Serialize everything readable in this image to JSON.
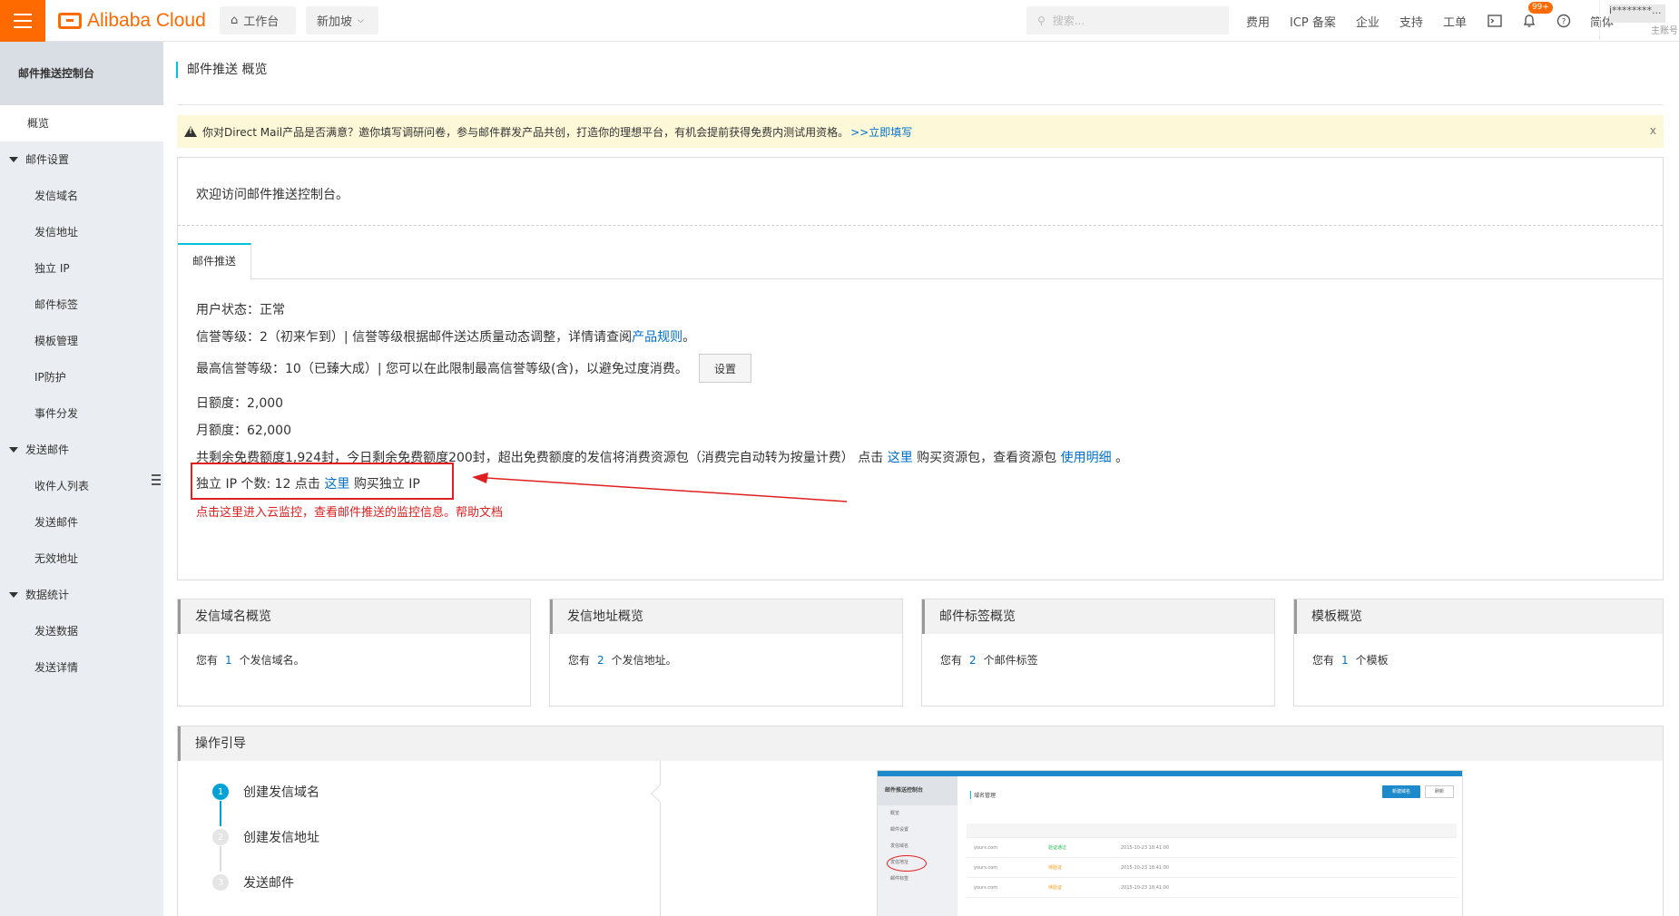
{
  "topbar": {
    "brand": "Alibaba Cloud",
    "workspace_label": "工作台",
    "region_label": "新加坡",
    "search_placeholder": "搜索...",
    "links": [
      "费用",
      "ICP 备案",
      "企业",
      "支持",
      "工单"
    ],
    "notification_badge": "99+",
    "lang_label": "简体",
    "user_name": "i********...",
    "user_sub": "主账号"
  },
  "sidebar": {
    "title": "邮件推送控制台",
    "overview": "概览",
    "groups": [
      {
        "label": "邮件设置",
        "items": [
          "发信域名",
          "发信地址",
          "独立 IP",
          "邮件标签",
          "模板管理",
          "IP防护",
          "事件分发"
        ]
      },
      {
        "label": "发送邮件",
        "items": [
          "收件人列表",
          "发送邮件",
          "无效地址"
        ]
      },
      {
        "label": "数据统计",
        "items": [
          "发送数据",
          "发送详情"
        ]
      }
    ]
  },
  "breadcrumb": "邮件推送 概览",
  "notice": {
    "text": "你对Direct Mail产品是否满意？邀你填写调研问卷，参与邮件群发产品共创，打造你的理想平台，有机会提前获得免费内测试用资格。",
    "link": ">>立即填写",
    "close": "x"
  },
  "panel": {
    "welcome": "欢迎访问邮件推送控制台。",
    "tab": "邮件推送",
    "user_status": "用户状态：正常",
    "reputation_text": "信誉等级：2（初来乍到）| 信誉等级根据邮件送达质量动态调整，详情请查阅",
    "reputation_link": "产品规则",
    "reputation_end": "。",
    "max_reputation": "最高信誉等级：10（已臻大成）| 您可以在此限制最高信誉等级(含)，以避免过度消费。",
    "set_button": "设置",
    "daily_quota": "日额度：2,000",
    "monthly_quota": "月额度：62,000",
    "free_quota_text": "共剩余免费额度1,924封，今日剩余免费额度200封，超出免费额度的发信将消费资源包（消费完自动转为按量计费）   点击",
    "free_quota_link": "这里",
    "free_quota_mid": "购买资源包，查看资源包",
    "free_quota_link2": "使用明细",
    "free_quota_end": "。",
    "ip_text": "独立 IP 个数:  12 点击",
    "ip_link": "这里",
    "ip_end": "购买独立 IP",
    "monitor_text": "点击这里进入云监控，查看邮件推送的监控信息。帮助文档"
  },
  "cards": [
    {
      "title": "发信域名概览",
      "prefix": "您有",
      "count": "1",
      "suffix": "个发信域名。"
    },
    {
      "title": "发信地址概览",
      "prefix": "您有",
      "count": "2",
      "suffix": "个发信地址。"
    },
    {
      "title": "邮件标签概览",
      "prefix": "您有",
      "count": "2",
      "suffix": "个邮件标签"
    },
    {
      "title": "模板概览",
      "prefix": "您有",
      "count": "1",
      "suffix": "个模板"
    }
  ],
  "guide": {
    "title": "操作引导",
    "steps": [
      {
        "num": "1",
        "label": "创建发信域名"
      },
      {
        "num": "2",
        "label": "创建发信地址"
      },
      {
        "num": "3",
        "label": "发送邮件"
      }
    ],
    "mini": {
      "side_title": "邮件推送控制台",
      "side_items": [
        "概览",
        "邮件设置",
        "发信域名",
        "发信地址",
        "邮件标签"
      ],
      "page_title": "域名管理",
      "new_button": "新建域名",
      "refresh_button": "刷新",
      "rows": [
        {
          "domain": "yours.com",
          "status": "验证通过",
          "time": "2015-10-23 18:41:00"
        },
        {
          "domain": "yours.com",
          "status": "待验证",
          "time": "2015-10-23 18:41:00"
        },
        {
          "domain": "yours.com",
          "status": "待验证",
          "time": "2015-10-23 18:41:00"
        }
      ]
    }
  }
}
